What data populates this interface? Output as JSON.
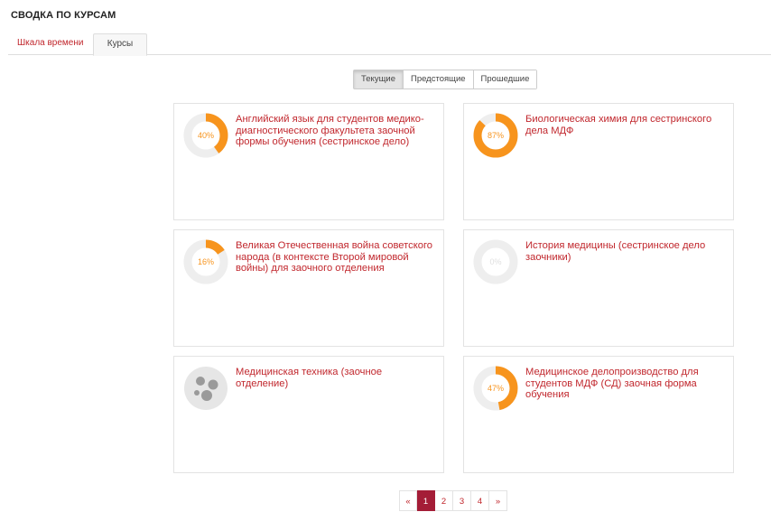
{
  "block": {
    "title": "СВОДКА ПО КУРСАМ"
  },
  "tabs": [
    {
      "label": "Шкала времени"
    },
    {
      "label": "Курсы"
    }
  ],
  "filters": [
    {
      "label": "Текущие",
      "active": true
    },
    {
      "label": "Предстоящие",
      "active": false
    },
    {
      "label": "Прошедшие",
      "active": false
    }
  ],
  "colors": {
    "accent": "#c1272d",
    "progress": "#f7941d",
    "track": "#eeeeee",
    "page_active": "#a41d37"
  },
  "courses": [
    {
      "name": "Английский язык для студентов медико-диагностического факультета заочной формы обучения (сестринское дело)",
      "progress": 40,
      "progress_label": "40%"
    },
    {
      "name": "Биологическая химия для сестринского дела МДФ",
      "progress": 87,
      "progress_label": "87%"
    },
    {
      "name": "Великая Отечественная война советского народа (в контексте Второй мировой войны) для заочного отделения",
      "progress": 16,
      "progress_label": "16%"
    },
    {
      "name": "История медицины (сестринское дело заочники)",
      "progress": 0,
      "progress_label": "0%"
    },
    {
      "name": "Медицинская техника (заочное отделение)",
      "progress": null,
      "progress_label": "",
      "icon": "course-default-icon"
    },
    {
      "name": "Медицинское делопроизводство для студентов МДФ (СД) заочная форма обучения",
      "progress": 47,
      "progress_label": "47%"
    }
  ],
  "pagination": {
    "prev": "«",
    "pages": [
      "1",
      "2",
      "3",
      "4"
    ],
    "next": "»",
    "current": "1"
  }
}
